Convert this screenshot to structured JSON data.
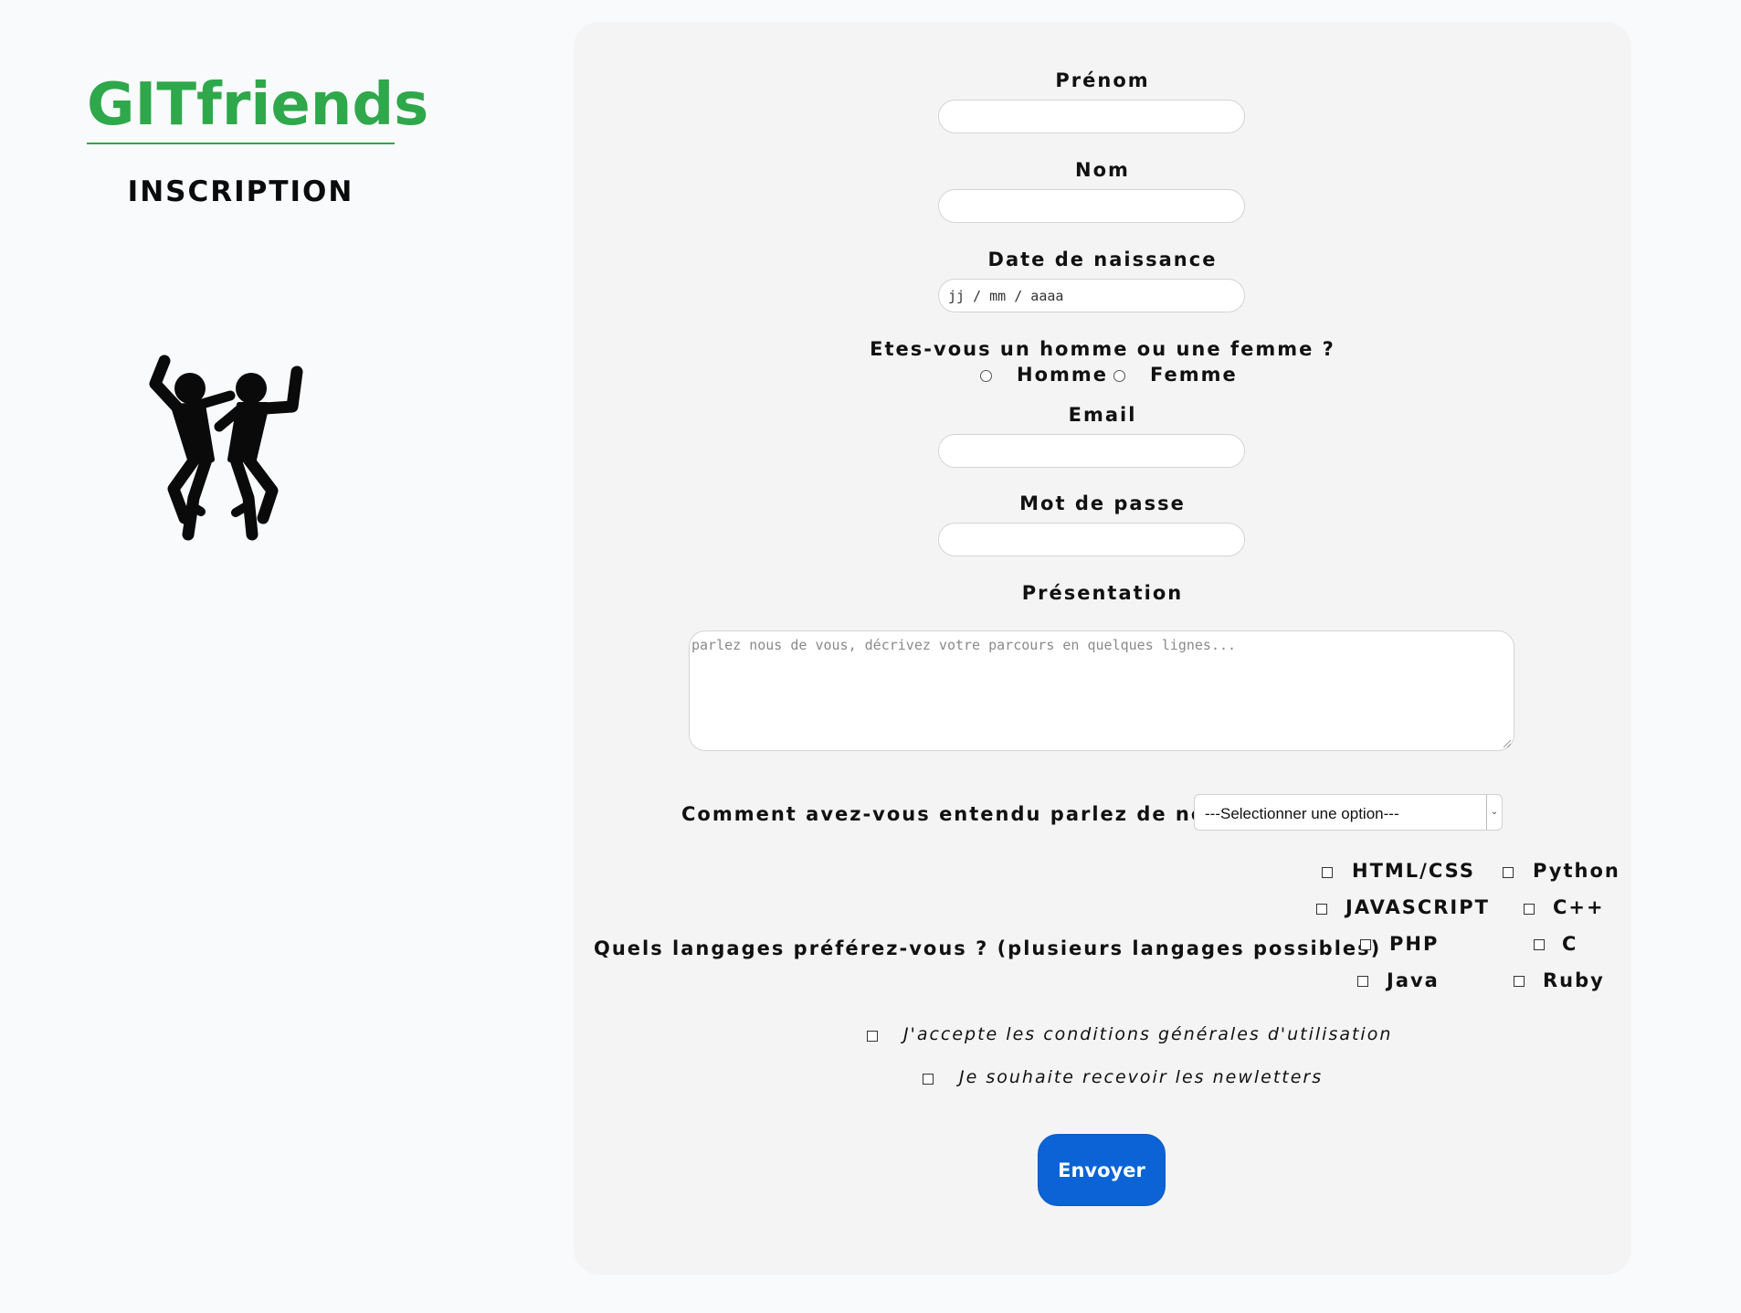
{
  "brand": {
    "logo_text": "GITfriends",
    "page_title": "INSCRIPTION",
    "color": "#2ea84a",
    "illustration": "dancing-people-icon"
  },
  "form": {
    "first_name": {
      "label": "Prénom",
      "value": ""
    },
    "last_name": {
      "label": "Nom",
      "value": ""
    },
    "birth_date": {
      "label": "Date de naissance",
      "placeholder": "jj / mm / aaaa"
    },
    "gender": {
      "question": "Etes-vous un homme ou une femme ?",
      "options": [
        "Homme",
        "Femme"
      ]
    },
    "email": {
      "label": "Email",
      "value": ""
    },
    "password": {
      "label": "Mot de passe",
      "value": ""
    },
    "presentation": {
      "label": "Présentation",
      "placeholder": "parlez nous de vous, décrivez votre parcours en quelques lignes..."
    },
    "source": {
      "label": "Comment avez-vous entendu parlez de nous?",
      "selected": "---Selectionner une option---"
    },
    "languages": {
      "question": "Quels langages préférez-vous ? (plusieurs langages possibles)",
      "options": [
        "HTML/CSS",
        "Python",
        "JAVASCRIPT",
        "C++",
        "PHP",
        "C",
        "Java",
        "Ruby"
      ]
    },
    "terms_label": "J'accepte les conditions générales d'utilisation",
    "newsletter_label": "Je souhaite recevoir les newletters",
    "submit_label": "Envoyer",
    "submit_color": "#0b63d6"
  }
}
